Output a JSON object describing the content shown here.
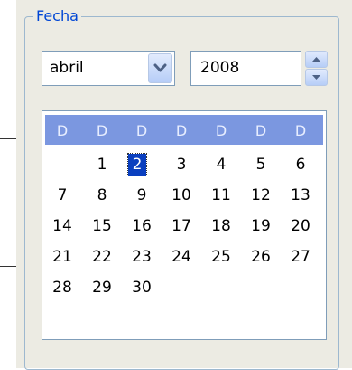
{
  "group": {
    "title": "Fecha"
  },
  "month": {
    "value": "abril",
    "options": [
      "abril"
    ]
  },
  "year": {
    "value": "2008"
  },
  "calendar": {
    "weekday_headers": [
      "D",
      "D",
      "D",
      "D",
      "D",
      "D",
      "D"
    ],
    "weeks": [
      [
        "",
        "1",
        "2",
        "3",
        "4",
        "5",
        "6"
      ],
      [
        "7",
        "8",
        "9",
        "10",
        "11",
        "12",
        "13"
      ],
      [
        "14",
        "15",
        "16",
        "17",
        "18",
        "19",
        "20"
      ],
      [
        "21",
        "22",
        "23",
        "24",
        "25",
        "26",
        "27"
      ],
      [
        "28",
        "29",
        "30",
        "",
        "",
        "",
        ""
      ]
    ],
    "selected_day": "2"
  },
  "colors": {
    "header_bg": "#7b97e0",
    "selected_bg": "#0a3fbf",
    "legend_text": "#0046d5"
  },
  "icons": {
    "dropdown": "chevron-down-icon",
    "spin_up": "arrow-up-icon",
    "spin_down": "arrow-down-icon"
  }
}
